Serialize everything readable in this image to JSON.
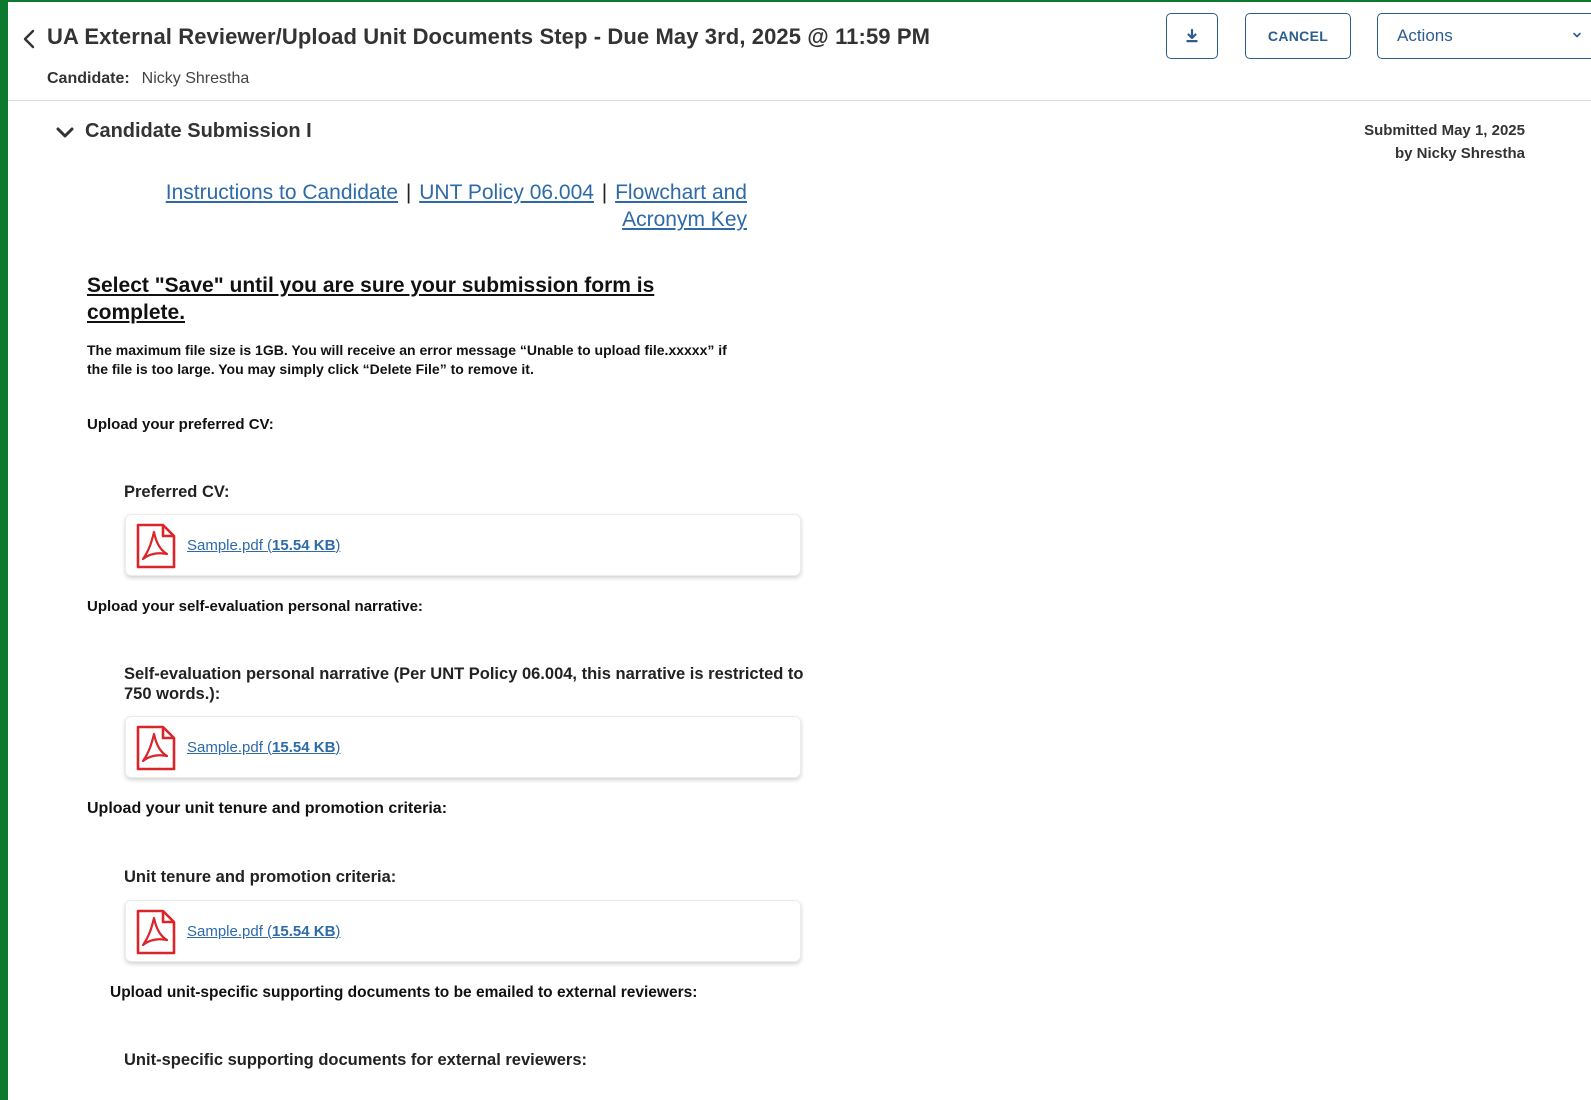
{
  "header": {
    "title": "UA External Reviewer/Upload Unit Documents Step - Due May 3rd, 2025 @ 11:59 PM",
    "candidate_label": "Candidate:",
    "candidate_name": "Nicky Shrestha",
    "cancel_label": "CANCEL",
    "actions_label": "Actions"
  },
  "section": {
    "title": "Candidate Submission I",
    "submitted_line1": "Submitted May 1, 2025",
    "submitted_line2": "by Nicky Shrestha"
  },
  "links": {
    "instructions": "Instructions to Candidate",
    "sep": "|",
    "policy": "UNT Policy 06.004",
    "flowchart_line1": "Flowchart and",
    "flowchart_line2": "Acronym Key"
  },
  "notice": {
    "save_heading": "Select \"Save\" until you are sure your submission form is complete.",
    "max_size_note": "The maximum file size is 1GB.  You will receive an error message “Unable to upload file.xxxxx” if the file is too large. You may simply click “Delete File” to remove it."
  },
  "uploads": [
    {
      "prompt": "Upload your preferred CV:",
      "field_label": "Preferred CV:",
      "file_name": "Sample.pdf (",
      "file_size": "15.54 KB",
      "file_close": ")"
    },
    {
      "prompt": "Upload your self-evaluation personal narrative:",
      "field_label": "Self-evaluation personal narrative (Per UNT Policy 06.004, this narrative is restricted to 750 words.):",
      "file_name": "Sample.pdf (",
      "file_size": "15.54 KB",
      "file_close": ")"
    },
    {
      "prompt": "Upload your unit tenure and promotion criteria:",
      "field_label": "Unit tenure and promotion criteria:",
      "file_name": "Sample.pdf (",
      "file_size": "15.54 KB",
      "file_close": ")"
    },
    {
      "prompt": "Upload unit-specific supporting documents to be emailed to external reviewers:",
      "field_label": "Unit-specific supporting documents for external reviewers:"
    }
  ],
  "icons": {
    "back": "chevron-left-icon",
    "download": "download-icon",
    "actions_caret": "chevron-down-icon",
    "section_toggle": "chevron-down-icon",
    "file": "pdf-file-icon"
  },
  "colors": {
    "accent": "#2c5d8f",
    "link": "#2e6aa8",
    "pdf_red": "#d9262b",
    "frame_green": "#0b7a2f"
  }
}
